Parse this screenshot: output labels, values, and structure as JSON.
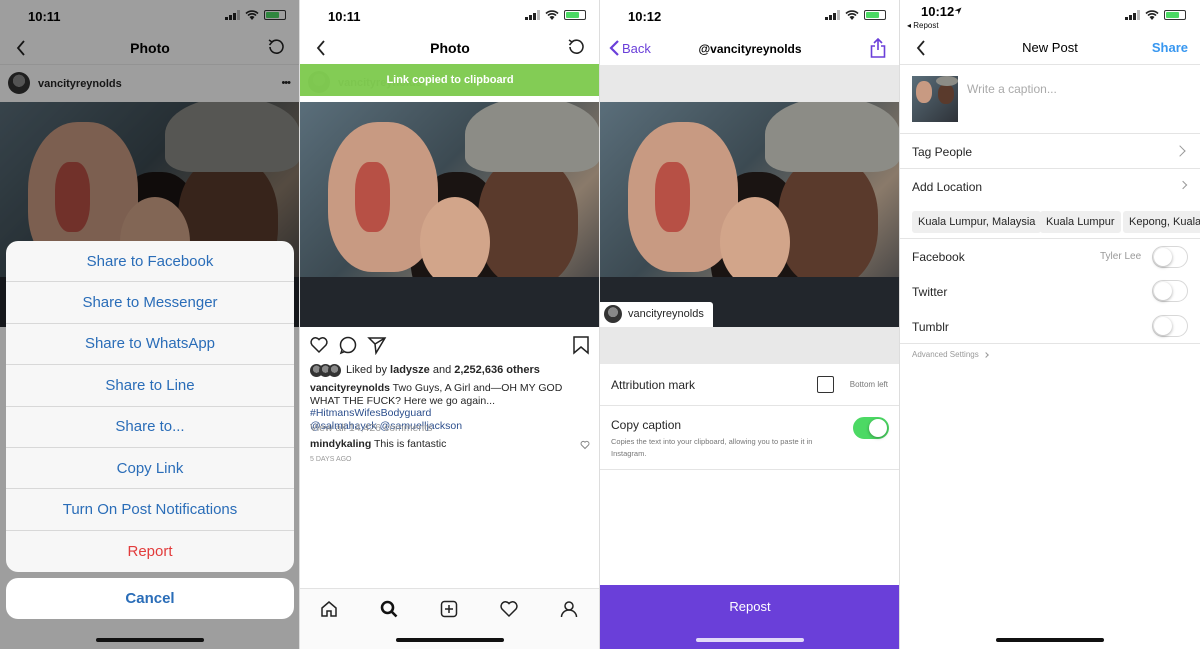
{
  "panel1": {
    "time": "10:11",
    "title": "Photo",
    "username": "vancityreynolds",
    "more": "•••",
    "sheet_items": [
      {
        "label": "Share to Facebook"
      },
      {
        "label": "Share to Messenger"
      },
      {
        "label": "Share to WhatsApp"
      },
      {
        "label": "Share to Line"
      },
      {
        "label": "Share to..."
      },
      {
        "label": "Copy Link"
      },
      {
        "label": "Turn On Post Notifications"
      },
      {
        "label": "Report"
      }
    ],
    "cancel": "Cancel"
  },
  "panel2": {
    "time": "10:11",
    "title": "Photo",
    "toast": "Link copied to clipboard",
    "username_faded": "vancityreynolds",
    "likes": {
      "prefix": "Liked by ",
      "user": "ladysze",
      "mid": " and ",
      "count": "2,252,636 others"
    },
    "caption": {
      "user": "vancityreynolds",
      "text": " Two Guys, A Girl and—OH MY GOD WHAT THE FUCK? Here we go again... ",
      "hashtag": "#HitmansWifesBodyguard",
      "mentions": "@salmahayek @samuelljackson"
    },
    "view_comments": "View all 14,426 comments",
    "comment": {
      "user": "mindykaling",
      "text": " This is fantastic"
    },
    "date": "5 DAYS AGO"
  },
  "panel3": {
    "time": "10:12",
    "back": "Back",
    "title": "@vancityreynolds",
    "username": "vancityreynolds",
    "attribution_label": "Attribution mark",
    "attribution_position": "Bottom left",
    "copy_caption_label": "Copy caption",
    "copy_caption_desc": "Copies the text into your clipboard, allowing you to paste it in Instagram.",
    "copy_caption_on": true,
    "repost_button": "Repost",
    "accent": "#6a3fd9"
  },
  "panel4": {
    "time": "10:12",
    "back_app": "◂ Repost",
    "title": "New Post",
    "share": "Share",
    "caption_placeholder": "Write a caption...",
    "tag_people": "Tag People",
    "add_location": "Add Location",
    "locations": [
      "Kuala Lumpur, Malaysia",
      "Kuala Lumpur",
      "Kepong, Kuala"
    ],
    "facebook": "Facebook",
    "facebook_account": "Tyler Lee",
    "twitter": "Twitter",
    "tumblr": "Tumblr",
    "advanced": "Advanced Settings",
    "accent": "#3897f0"
  }
}
